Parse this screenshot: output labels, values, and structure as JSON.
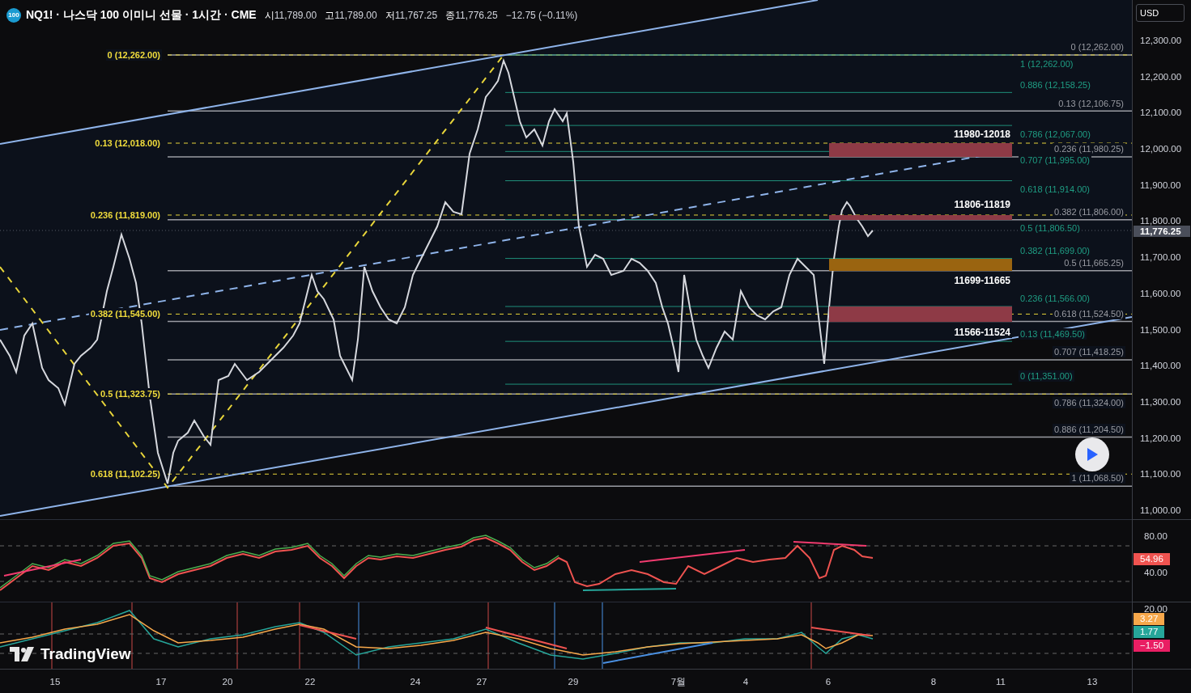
{
  "header": {
    "exchange_badge": "100",
    "title": "NQ1! · 나스닥 100 이미니 선물 · 1시간 · CME",
    "ohlc": [
      {
        "label": "시",
        "value": "11,789.00"
      },
      {
        "label": "고",
        "value": "11,789.00"
      },
      {
        "label": "저",
        "value": "11,767.25"
      },
      {
        "label": "종",
        "value": "11,776.25"
      }
    ],
    "change": "−12.75 (−0.11%)"
  },
  "currency": "USD",
  "price_axis": {
    "ticks": [
      "12,300.00",
      "12,200.00",
      "12,100.00",
      "12,000.00",
      "11,900.00",
      "11,800.00",
      "11,700.00",
      "11,600.00",
      "11,500.00",
      "11,400.00",
      "11,300.00",
      "11,200.00",
      "11,100.00",
      "11,000.00"
    ],
    "last_price": "11,776.25"
  },
  "fib_left": [
    "0 (12,262.00)",
    "0.13 (12,018.00)",
    "0.236 (11,819.00)",
    "0.382 (11,545.00)",
    "0.5 (11,323.75)",
    "0.618 (11,102.25)"
  ],
  "fib_right_gray": [
    "0 (12,262.00)",
    "0.13 (12,106.75)",
    "0.236 (11,980.25)",
    "0.382 (11,806.00)",
    "0.5 (11,665.25)",
    "0.618 (11,524.50)",
    "0.707 (11,418.25)",
    "0.786 (11,324.00)",
    "0.886 (11,204.50)",
    "1 (11,068.50)"
  ],
  "fib_right_teal": [
    "1 (12,262.00)",
    "0.886 (12,158.25)",
    "0.786 (12,067.00)",
    "0.707 (11,995.00)",
    "0.618 (11,914.00)",
    "0.5 (11,806.50)",
    "0.382 (11,699.00)",
    "0.236 (11,566.00)",
    "0.13 (11,469.50)",
    "0 (11,351.00)"
  ],
  "zones": [
    {
      "label": "11980-12018",
      "color": "#8e3a46"
    },
    {
      "label": "11806-11819",
      "color": "#8e3a46"
    },
    {
      "label": "11699-11665",
      "color": "#9a6410"
    },
    {
      "label": "11566-11524",
      "color": "#8e3a46"
    }
  ],
  "rsi": {
    "ticks": [
      "80.00",
      "40.00"
    ],
    "value": {
      "text": "54.96",
      "color": "#f05350"
    }
  },
  "macd": {
    "tick": "20.00",
    "values": [
      {
        "text": "3.27",
        "color": "#f7a84b"
      },
      {
        "text": "1.77",
        "color": "#26a69a"
      },
      {
        "text": "−1.50",
        "color": "#e91e63"
      }
    ]
  },
  "time_axis": [
    "15",
    "17",
    "20",
    "22",
    "24",
    "27",
    "29",
    "7월",
    "4",
    "6",
    "8",
    "11",
    "13"
  ],
  "logo": "TradingView"
}
